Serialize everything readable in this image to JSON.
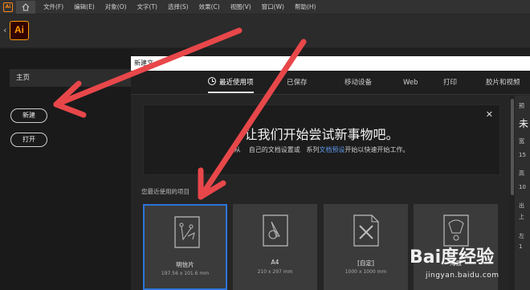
{
  "menubar": {
    "app_icon": "Ai",
    "items": [
      "文件(F)",
      "编辑(E)",
      "对象(O)",
      "文字(T)",
      "选择(S)",
      "效果(C)",
      "视图(V)",
      "窗口(W)",
      "帮助(H)"
    ]
  },
  "appbar": {
    "back": "‹",
    "logo": "Ai"
  },
  "left_panel": {
    "home_label": "主页",
    "new_button": "新建",
    "open_button": "打开"
  },
  "dialog": {
    "title": "新建文",
    "tabs": [
      {
        "label": "最近使用项",
        "active": true
      },
      {
        "label": "已保存",
        "active": false
      },
      {
        "label": "移动设备",
        "active": false
      },
      {
        "label": "Web",
        "active": false
      },
      {
        "label": "打印",
        "active": false
      },
      {
        "label": "胶片和视频",
        "active": false
      }
    ],
    "banner": {
      "close": "✕",
      "headline": "让我们开始尝试新事物吧。",
      "sub_before": "从",
      "sub_mid": "自己的文档设置或",
      "sub_mid2": "系列",
      "sub_link": "文档预设",
      "sub_after": "开始以快速开始工作。"
    },
    "recent_label": "您最近使用的项目",
    "cards": [
      {
        "name": "明信片",
        "size": "197.56 x 101.6 mm",
        "icon": "postcard-icon"
      },
      {
        "name": "A4",
        "size": "210 x 297 mm",
        "icon": "a4-doc-icon"
      },
      {
        "name": "[自定]",
        "size": "1000 x 1000 mm",
        "icon": "custom-doc-icon"
      },
      {
        "name": "海报",
        "size": "",
        "icon": "poster-doc-icon"
      }
    ],
    "right_panel": [
      "预",
      "未",
      "宽",
      "15",
      "高",
      "10",
      "出",
      "上",
      "左",
      "1"
    ]
  },
  "watermark": {
    "text": "Bai度经验",
    "url": "jingyan.baidu.com"
  },
  "colors": {
    "selected_border": "#2d74da",
    "annotation_arrow": "#e8474a",
    "ai_orange": "#ff9a00"
  }
}
